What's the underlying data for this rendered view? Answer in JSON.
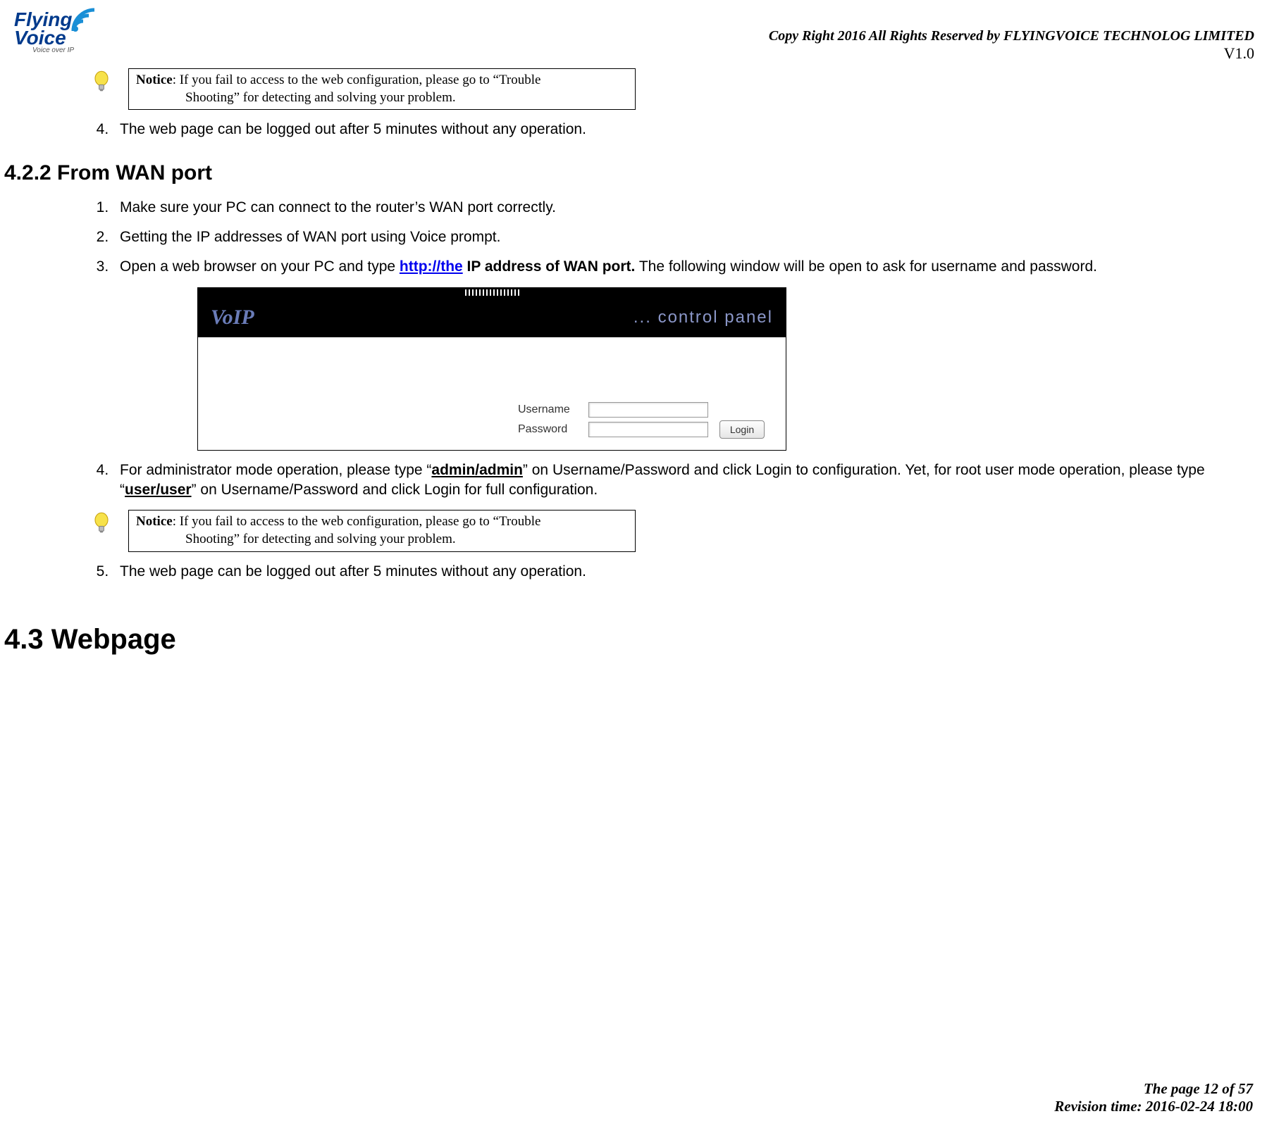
{
  "logo": {
    "line1": "Flying",
    "line2": "Voice",
    "tagline": "Voice over IP"
  },
  "header": {
    "copyright": "Copy Right 2016 All Rights Reserved by FLYINGVOICE TECHNOLOG LIMITED",
    "version": "V1.0"
  },
  "notice1": {
    "label": "Notice",
    "text1": ": If you fail to access to the web configuration, please go to “Trouble",
    "text2": "Shooting” for detecting and solving your problem."
  },
  "section_4_2_1": {
    "item4": "The web page can be logged out after 5 minutes without any operation."
  },
  "section_4_2_2": {
    "title": "4.2.2 From WAN port",
    "item1": "Make sure your PC can connect to the router’s WAN port correctly.",
    "item2": "Getting the IP addresses of WAN port using Voice prompt.",
    "item3_pre": "Open a web browser on your PC and type ",
    "item3_link": "http://the",
    "item3_bold": " IP address of WAN port.",
    "item3_post": " The following window will be open to ask for username and password.",
    "item4_pre": "For administrator mode operation, please type “",
    "item4_b1": "admin/admin",
    "item4_mid": "” on Username/Password and click Login to configuration. Yet, for root user mode operation, please type “",
    "item4_b2": "user/user",
    "item4_post": "” on Username/Password and click Login for full configuration.",
    "item5": "The web page can be logged out after 5 minutes without any operation."
  },
  "notice2": {
    "label": "Notice",
    "text1": ": If you fail to access to the web configuration, please go to “Trouble",
    "text2": "Shooting” for detecting and solving your problem."
  },
  "panel": {
    "voip": "VoIP",
    "control_panel": "... control panel",
    "username_label": "Username",
    "password_label": "Password",
    "login": "Login"
  },
  "section_4_3": {
    "title": "4.3 Webpage"
  },
  "footer": {
    "page": "The page 12 of 57",
    "revision": "Revision time: 2016-02-24 18:00"
  }
}
